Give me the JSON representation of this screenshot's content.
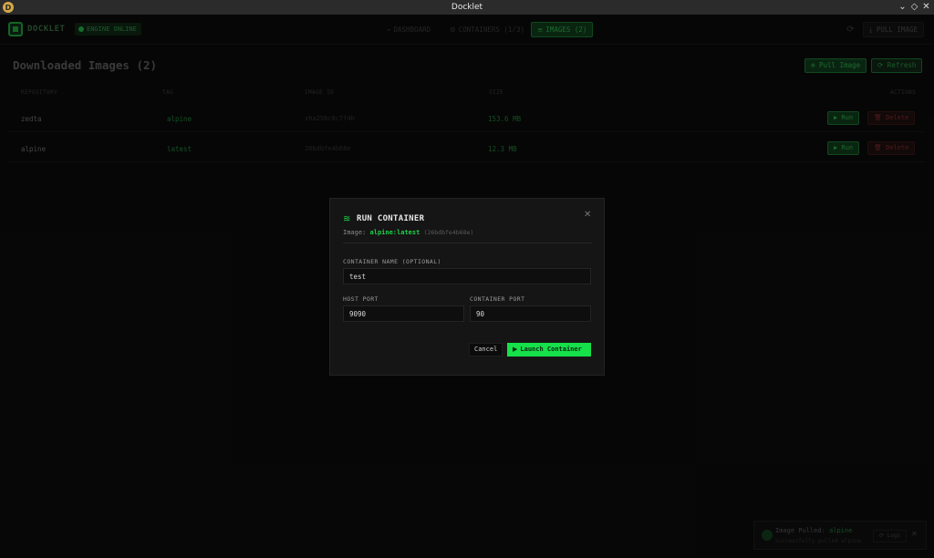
{
  "window": {
    "title": "Docklet",
    "minimize": "⌄",
    "restore": "◇",
    "close": "✕"
  },
  "header": {
    "logo": "DOCKLET",
    "engine_status": "ENGINE ONLINE",
    "nav": [
      {
        "icon": "⌁",
        "label": "DASHBOARD"
      },
      {
        "icon": "⚙",
        "label": "CONTAINERS (1/3)"
      },
      {
        "icon": "≡",
        "label": "IMAGES (2)"
      }
    ],
    "refresh_icon": "⟳",
    "pull_button": "⤓ PULL IMAGE"
  },
  "page": {
    "title": "Downloaded Images (2)",
    "pull_button": "⊕ Pull Image",
    "refresh_button": "⟳ Refresh",
    "columns": [
      "REPOSITORY",
      "TAG",
      "IMAGE ID",
      "SIZE",
      "ACTIONS"
    ],
    "rows": [
      {
        "repo": "zedta",
        "tag": "alpine",
        "image_id": "sha256c8c7f4b",
        "size": "153.6 MB",
        "run": "▶ Run",
        "delete": "🗑 Delete"
      },
      {
        "repo": "alpine",
        "tag": "latest",
        "image_id": "26bdbfe4b68e",
        "size": "12.3 MB",
        "run": "▶ Run",
        "delete": "🗑 Delete"
      }
    ]
  },
  "modal": {
    "icon": "≋",
    "title": "RUN CONTAINER",
    "close": "✕",
    "subtitle_prefix": "Image:",
    "image": "alpine:latest",
    "image_hash": "(26bdbfe4b68e)",
    "name_label": "CONTAINER NAME (OPTIONAL)",
    "name_value": "test",
    "host_port_label": "HOST PORT",
    "host_port_value": "9090",
    "container_port_label": "CONTAINER PORT",
    "container_port_value": "90",
    "cancel": "Cancel",
    "launch_icon": "▶",
    "launch": "Launch Container"
  },
  "toast": {
    "title_prefix": "Image Pulled:",
    "title_image": "alpine",
    "subtitle": "Successfully pulled alpine",
    "button": "⟳ Logs",
    "close": "✕"
  },
  "colors": {
    "accent": "#16e04a",
    "danger": "#7a2a2a",
    "background": "#0a0a0a",
    "modal": "#151515"
  }
}
